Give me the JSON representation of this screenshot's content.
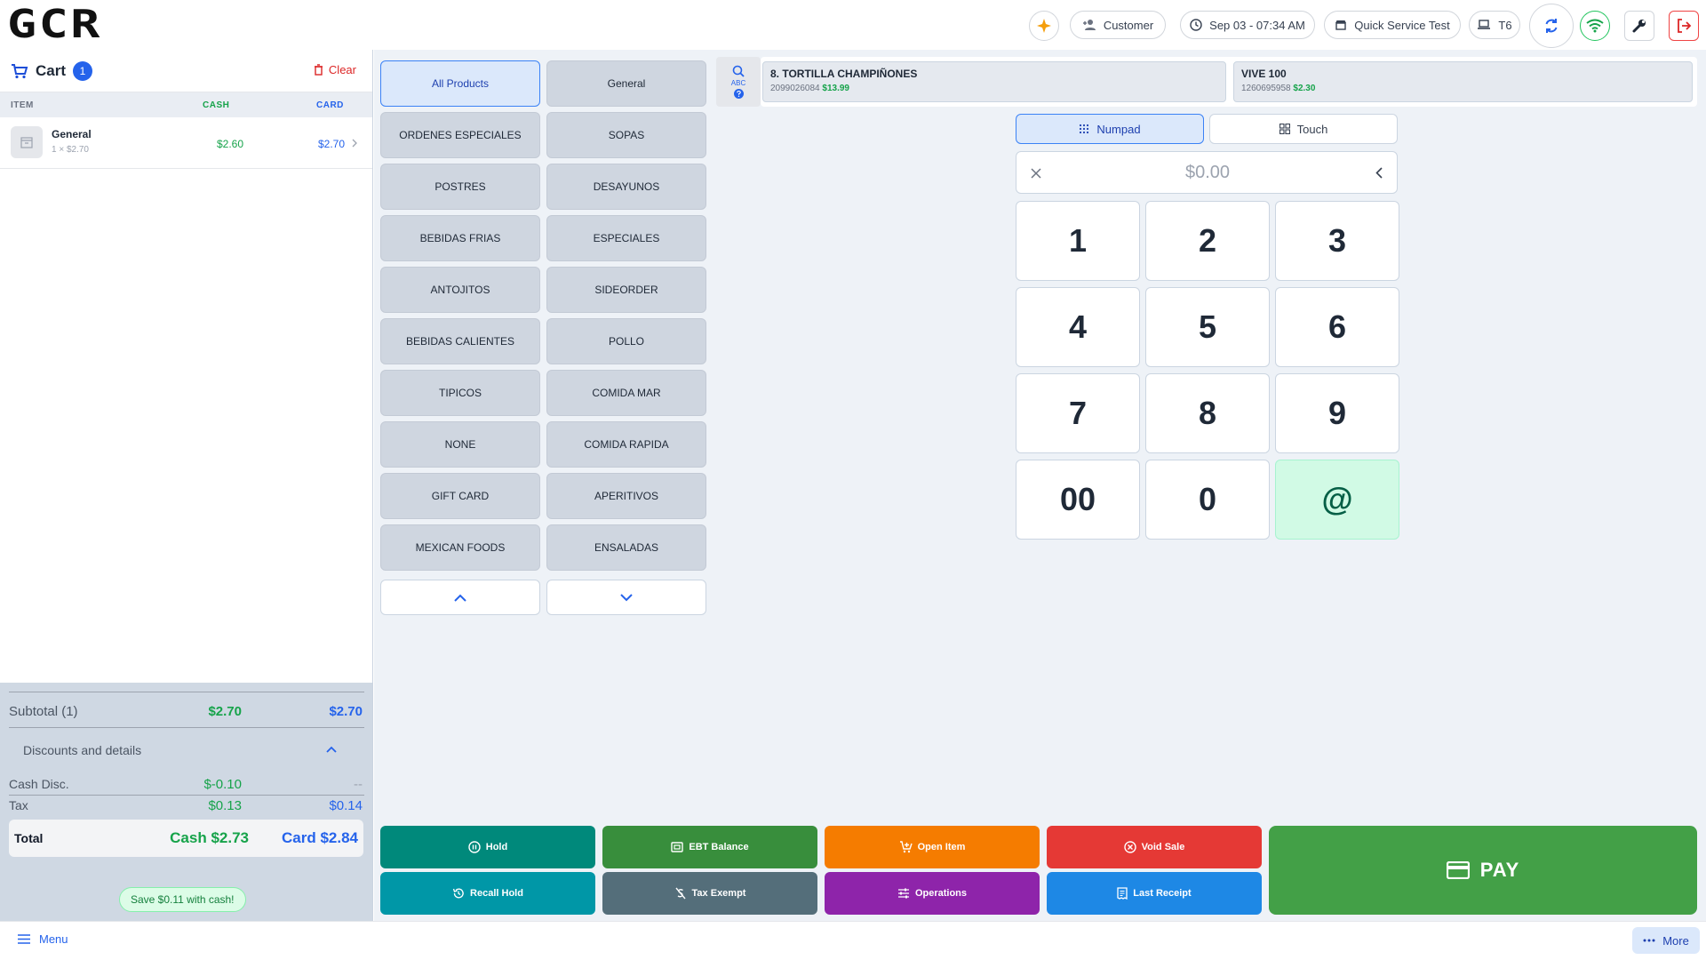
{
  "header": {
    "logo_text": "GCR",
    "customer_label": "Customer",
    "datetime": "Sep 03 - 07:34 AM",
    "store_name": "Quick Service Test",
    "terminal": "T6"
  },
  "cart": {
    "title": "Cart",
    "count": "1",
    "clear_label": "Clear",
    "columns": {
      "item": "ITEM",
      "cash": "CASH",
      "card": "CARD"
    },
    "items": [
      {
        "name": "General",
        "qty_price": "1 × $2.70",
        "cash": "$2.60",
        "card": "$2.70"
      }
    ],
    "summary": {
      "subtotal_label": "Subtotal (1)",
      "subtotal_cash": "$2.70",
      "subtotal_card": "$2.70",
      "discounts_label": "Discounts and details",
      "cash_disc_label": "Cash Disc.",
      "cash_disc_cash": "$-0.10",
      "cash_disc_card": "--",
      "tax_label": "Tax",
      "tax_cash": "$0.13",
      "tax_card": "$0.14",
      "total_label": "Total",
      "total_cash": "Cash $2.73",
      "total_card": "Card $2.84",
      "save_message": "Save $0.11 with cash!"
    }
  },
  "categories": [
    "All Products",
    "General",
    "ORDENES ESPECIALES",
    "SOPAS",
    "POSTRES",
    "DESAYUNOS",
    "BEBIDAS FRIAS",
    "ESPECIALES",
    "ANTOJITOS",
    "SIDEORDER",
    "BEBIDAS CALIENTES",
    "POLLO",
    "TIPICOS",
    "COMIDA MAR",
    "NONE",
    "COMIDA RAPIDA",
    "GIFT CARD",
    "APERITIVOS",
    "MEXICAN FOODS",
    "ENSALADAS"
  ],
  "search": {
    "mode_label": "ABC"
  },
  "featured": [
    {
      "name": "8. TORTILLA CHAMPIÑONES",
      "code": "2099026084",
      "price": "$13.99"
    },
    {
      "name": "VIVE 100",
      "code": "1260695958",
      "price": "$2.30"
    }
  ],
  "numpad": {
    "mode_numpad": "Numpad",
    "mode_touch": "Touch",
    "amount": "$0.00",
    "keys": [
      "1",
      "2",
      "3",
      "4",
      "5",
      "6",
      "7",
      "8",
      "9",
      "00",
      "0",
      "@"
    ]
  },
  "actions": {
    "hold": "Hold",
    "ebt_balance": "EBT Balance",
    "open_item": "Open Item",
    "void_sale": "Void Sale",
    "recall_hold": "Recall Hold",
    "tax_exempt": "Tax Exempt",
    "operations": "Operations",
    "last_receipt": "Last Receipt",
    "pay": "PAY"
  },
  "footer": {
    "menu": "Menu",
    "more": "More"
  },
  "colors": {
    "accent_blue": "#2563eb",
    "cash_green": "#16a34a",
    "pay_green": "#43a047",
    "hold_teal": "#00897b",
    "ebt_green": "#388e3c",
    "open_orange": "#f57c00",
    "void_red": "#e53935",
    "recall_cyan": "#0097a7",
    "tax_slate": "#546e7a",
    "ops_purple": "#8e24aa",
    "receipt_blue": "#1e88e5"
  }
}
